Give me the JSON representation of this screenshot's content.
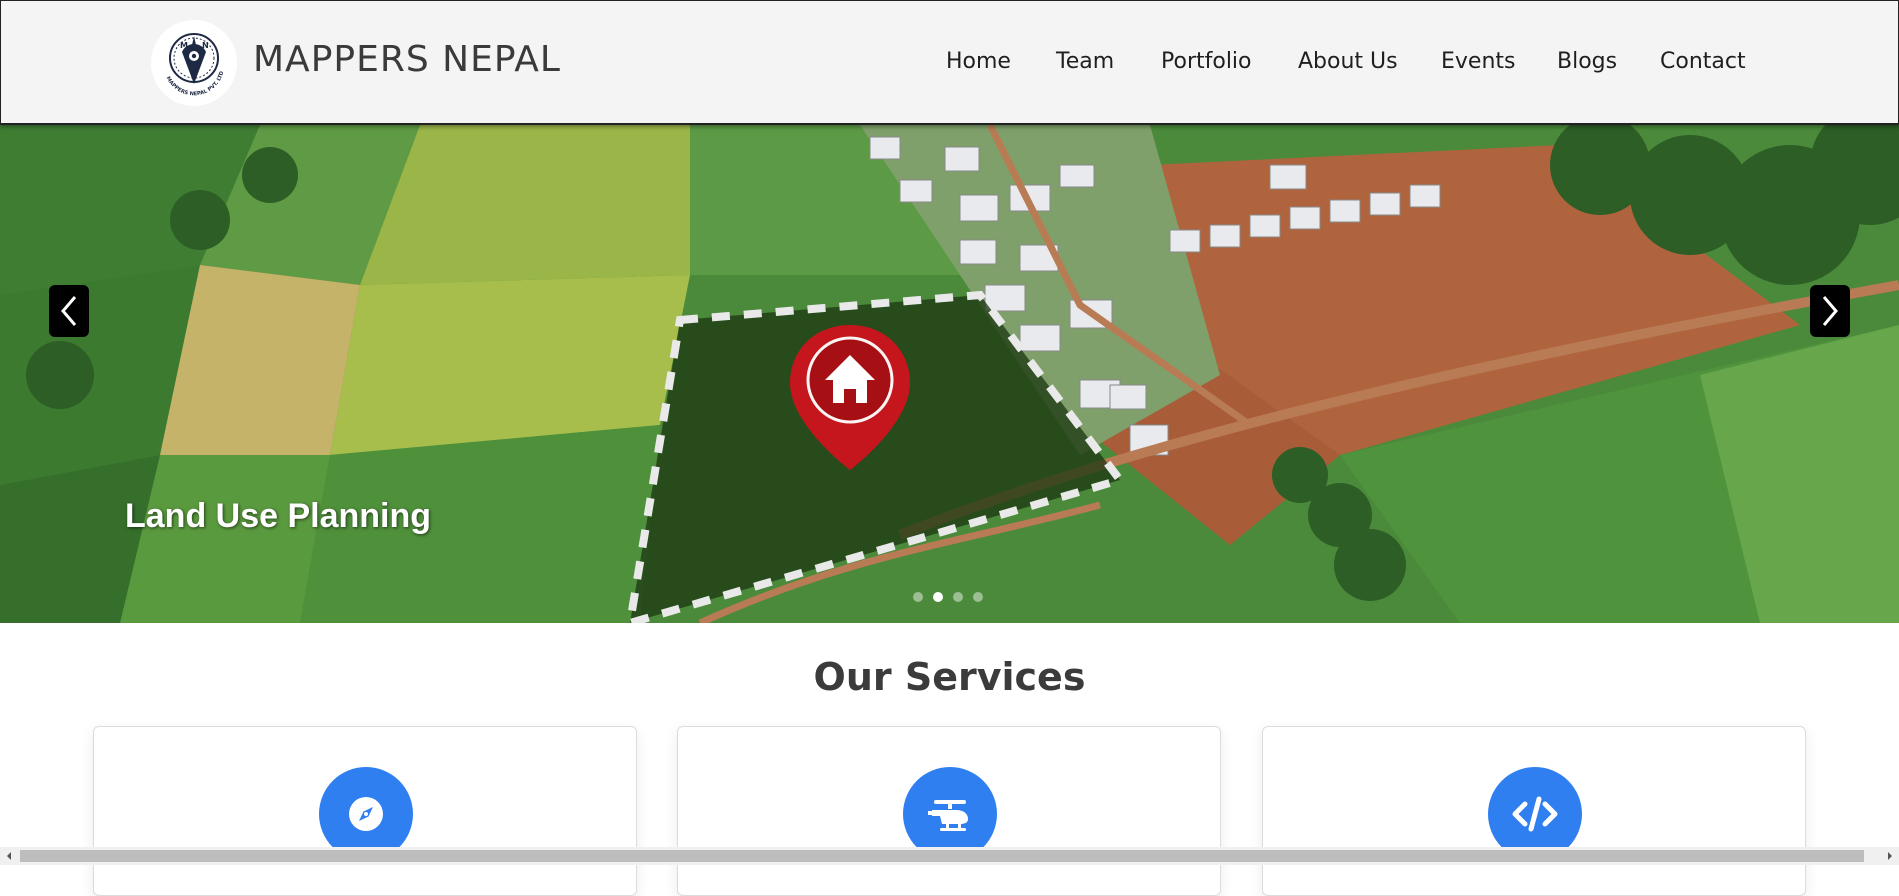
{
  "header": {
    "brand_name": "MAPPERS NEPAL",
    "logo_text": "MAPPERS NEPAL PVT. LTD."
  },
  "nav": {
    "items": [
      {
        "label": "Home"
      },
      {
        "label": "Team"
      },
      {
        "label": "Portfolio"
      },
      {
        "label": "About Us"
      },
      {
        "label": "Events"
      },
      {
        "label": "Blogs"
      },
      {
        "label": "Contact"
      }
    ]
  },
  "hero": {
    "caption": "Land Use Planning",
    "slide_count": 4,
    "active_slide": 2
  },
  "services": {
    "title": "Our Services",
    "cards": [
      {
        "icon": "compass-icon"
      },
      {
        "icon": "helicopter-icon"
      },
      {
        "icon": "code-icon"
      }
    ]
  },
  "colors": {
    "accent": "#2f7ff0",
    "header_bg": "#f4f4f4",
    "pin_red": "#c4161c"
  }
}
